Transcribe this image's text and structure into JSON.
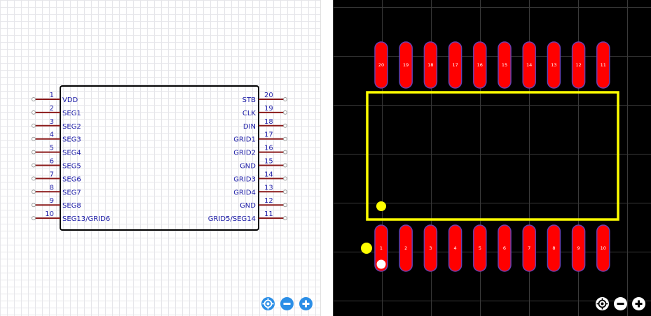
{
  "schematic": {
    "left_pins": [
      {
        "num": "1",
        "name": "VDD"
      },
      {
        "num": "2",
        "name": "SEG1"
      },
      {
        "num": "3",
        "name": "SEG2"
      },
      {
        "num": "4",
        "name": "SEG3"
      },
      {
        "num": "5",
        "name": "SEG4"
      },
      {
        "num": "6",
        "name": "SEG5"
      },
      {
        "num": "7",
        "name": "SEG6"
      },
      {
        "num": "8",
        "name": "SEG7"
      },
      {
        "num": "9",
        "name": "SEG8"
      },
      {
        "num": "10",
        "name": "SEG13/GRID6"
      }
    ],
    "right_pins": [
      {
        "num": "20",
        "name": "STB"
      },
      {
        "num": "19",
        "name": "CLK"
      },
      {
        "num": "18",
        "name": "DIN"
      },
      {
        "num": "17",
        "name": "GRID1"
      },
      {
        "num": "16",
        "name": "GRID2"
      },
      {
        "num": "15",
        "name": "GND"
      },
      {
        "num": "14",
        "name": "GRID3"
      },
      {
        "num": "13",
        "name": "GRID4"
      },
      {
        "num": "12",
        "name": "GND"
      },
      {
        "num": "11",
        "name": "GRID5/SEG14"
      }
    ],
    "colors": {
      "pin_line": "#8b1a1a",
      "text": "#1a1aa6",
      "body": "#000000"
    }
  },
  "pcb": {
    "top_pads": [
      "20",
      "19",
      "18",
      "17",
      "16",
      "15",
      "14",
      "13",
      "12",
      "11"
    ],
    "bottom_pads": [
      "1",
      "2",
      "3",
      "4",
      "5",
      "6",
      "7",
      "8",
      "9",
      "10"
    ],
    "colors": {
      "pad": "#ff0000",
      "pad_outline": "#6a3fb0",
      "silkscreen": "#ffff00",
      "pad_text": "#ffffff"
    }
  },
  "controls": {
    "schematic": [
      "locate-icon",
      "zoom-out-icon",
      "zoom-in-icon"
    ],
    "pcb": [
      "locate-icon",
      "zoom-out-icon",
      "zoom-in-icon"
    ]
  }
}
